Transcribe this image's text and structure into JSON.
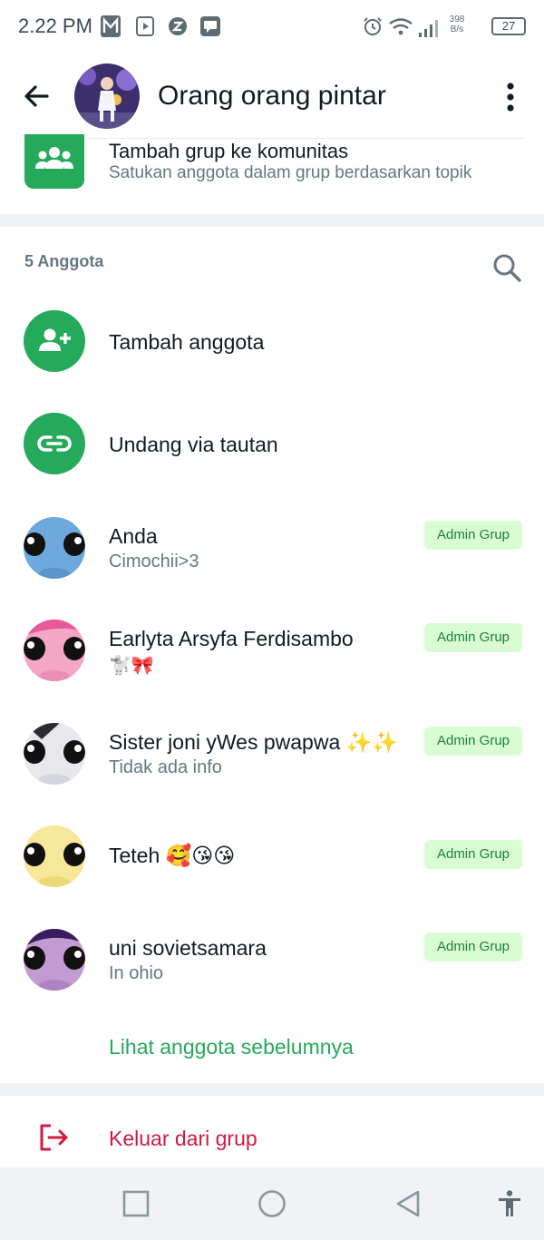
{
  "status_bar": {
    "time": "2.22 PM",
    "speed_value": "398",
    "speed_unit": "B/s",
    "battery": "27"
  },
  "header": {
    "title": "Orang orang pintar"
  },
  "community": {
    "title": "Tambah grup ke komunitas",
    "subtitle": "Satukan anggota dalam grup berdasarkan topik"
  },
  "members_section": {
    "count_label": "5 Anggota",
    "add_member": "Tambah anggota",
    "invite_link": "Undang via tautan",
    "members": [
      {
        "name": "Anda",
        "about": "Cimochii>3",
        "badge": "Admin Grup",
        "color": "#6fa8dc"
      },
      {
        "name": "Earlyta Arsyfa Ferdisambo",
        "about": "🐩🎀",
        "badge": "Admin Grup",
        "color": "#f4a7c4"
      },
      {
        "name": "Sister joni yWes pwapwa ✨✨",
        "about": "Tidak ada info",
        "badge": "Admin Grup",
        "color": "#e8e8ec"
      },
      {
        "name": "Teteh 🥰😘😘",
        "about": "",
        "badge": "Admin Grup",
        "color": "#f7e79a"
      },
      {
        "name": "uni sovietsamara",
        "about": "In ohio",
        "badge": "Admin Grup",
        "color": "#c39bd3"
      }
    ],
    "see_more": "Lihat anggota sebelumnya"
  },
  "exit": {
    "label": "Keluar dari grup"
  },
  "colors": {
    "accent_green": "#25a95a",
    "danger_red": "#d1193f",
    "badge_bg": "#d9fdd3"
  }
}
